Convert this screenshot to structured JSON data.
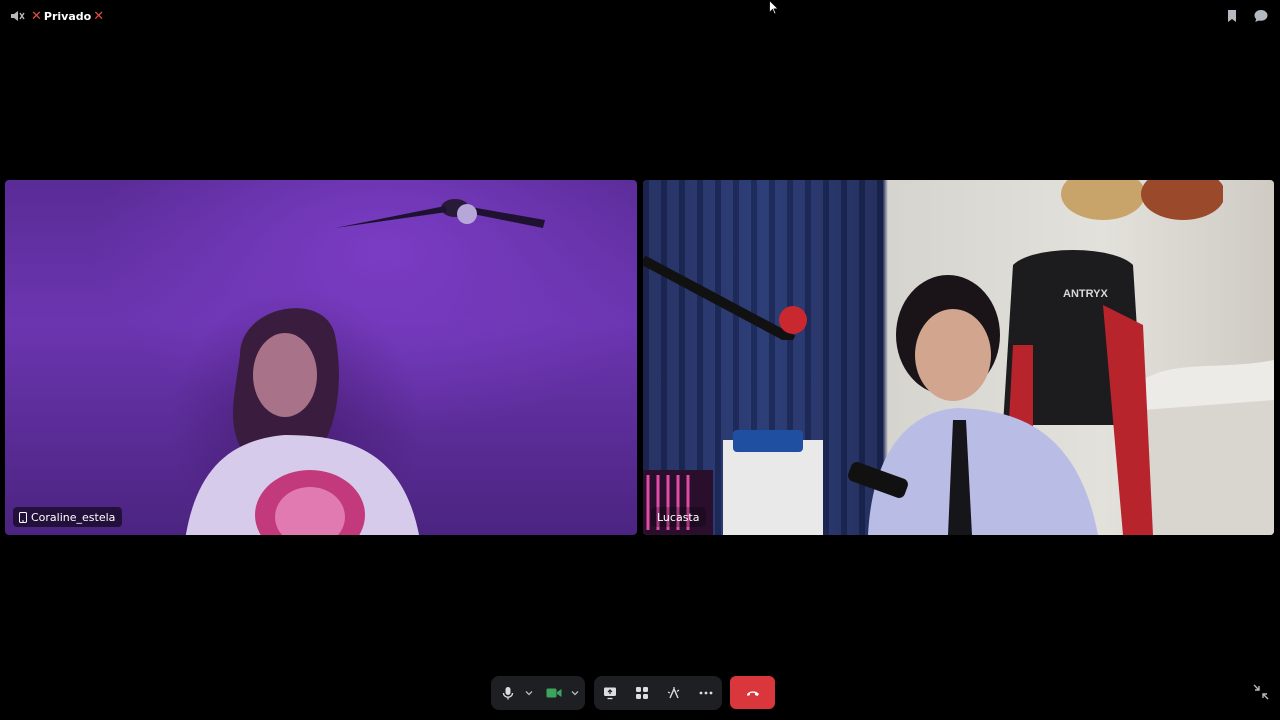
{
  "header": {
    "channel_name": "Privado",
    "x_mark": "✕",
    "icons": [
      "speaker-muted-icon",
      "bookmark-icon",
      "chat-bubble-icon"
    ]
  },
  "participants": [
    {
      "name": "Coraline_estela",
      "device_icon": "mobile-phone-icon",
      "speaking": false
    },
    {
      "name": "Lucasta",
      "speaking": true
    }
  ],
  "scene_text": {
    "chair_brand": "ANTRYX"
  },
  "controls": {
    "icons": [
      "microphone-icon",
      "chevron-down-icon",
      "camera-icon",
      "chevron-down-icon",
      "screen-share-icon",
      "activities-icon",
      "soundboard-icon",
      "more-options-icon",
      "hang-up-icon"
    ],
    "camera_active_color": "#3ba55d"
  },
  "colors": {
    "background": "#000000",
    "speaking_border": "#3ba55d",
    "hangup": "#da373c",
    "private_x": "#e74c3c",
    "control_bar": "#1e1f22"
  },
  "corner": {
    "icon": "collapse-icon"
  }
}
